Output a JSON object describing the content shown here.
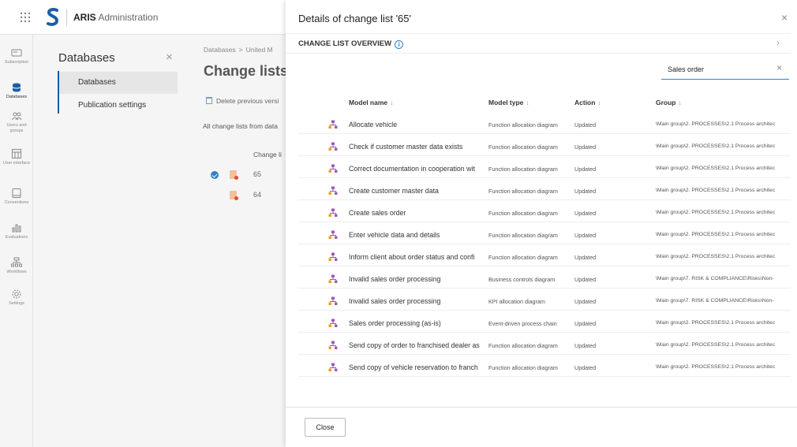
{
  "app": {
    "brand": "ARIS",
    "subtitle": "Administration"
  },
  "rail": [
    {
      "icon": "subscription-icon",
      "label": "Subscription"
    },
    {
      "icon": "database-icon",
      "label": "Databases",
      "active": true
    },
    {
      "icon": "users-icon",
      "label": "Users and groups"
    },
    {
      "icon": "user-interface-icon",
      "label": "User interface"
    },
    {
      "icon": "conventions-icon",
      "label": "Conventions"
    },
    {
      "icon": "evaluations-icon",
      "label": "Evaluations"
    },
    {
      "icon": "workflows-icon",
      "label": "Workflows"
    },
    {
      "icon": "settings-icon",
      "label": "Settings"
    }
  ],
  "subnav": {
    "title": "Databases",
    "close": "×",
    "items": [
      "Databases",
      "Publication settings"
    ]
  },
  "main": {
    "breadcrumb": [
      "Databases",
      "United M"
    ],
    "title": "Change lists",
    "delete_label": "Delete previous versi",
    "description": "All change lists from data",
    "column_header": "Change li",
    "rows": [
      "65",
      "64"
    ]
  },
  "dialog": {
    "title": "Details of change list '65'",
    "close": "×",
    "overview_label": "CHANGE LIST OVERVIEW",
    "overview_chevron": "›",
    "search_value": "Sales order",
    "search_clear": "×",
    "sort_arrow": "↓",
    "columns": [
      "Model name",
      "Model type",
      "Action",
      "Group"
    ],
    "rows": [
      {
        "name": "Allocate vehicle",
        "type": "Function allocation diagram",
        "action": "Updated",
        "group": "\\Main group\\2. PROCESSES\\2.1 Process architec"
      },
      {
        "name": "Check if customer master data exists",
        "type": "Function allocation diagram",
        "action": "Updated",
        "group": "\\Main group\\2. PROCESSES\\2.1 Process architec"
      },
      {
        "name": "Correct documentation in cooperation wit",
        "type": "Function allocation diagram",
        "action": "Updated",
        "group": "\\Main group\\2. PROCESSES\\2.1 Process architec"
      },
      {
        "name": "Create customer master data",
        "type": "Function allocation diagram",
        "action": "Updated",
        "group": "\\Main group\\2. PROCESSES\\2.1 Process architec"
      },
      {
        "name": "Create sales order",
        "type": "Function allocation diagram",
        "action": "Updated",
        "group": "\\Main group\\2. PROCESSES\\2.1 Process architec"
      },
      {
        "name": "Enter vehicle data and details",
        "type": "Function allocation diagram",
        "action": "Updated",
        "group": "\\Main group\\2. PROCESSES\\2.1 Process architec"
      },
      {
        "name": "Inform client about order status and confi",
        "type": "Function allocation diagram",
        "action": "Updated",
        "group": "\\Main group\\2. PROCESSES\\2.1 Process architec"
      },
      {
        "name": "Invalid sales order processing",
        "type": "Business controls diagram",
        "action": "Updated",
        "group": "\\Main group\\7. RISK & COMPLIANCE\\Risks\\Non-"
      },
      {
        "name": "Invalid sales order processing",
        "type": "KPI allocation diagram",
        "action": "Updated",
        "group": "\\Main group\\7. RISK & COMPLIANCE\\Risks\\Non-"
      },
      {
        "name": "Sales order processing (as-is)",
        "type": "Event-driven process chain",
        "action": "Updated",
        "group": "\\Main group\\2. PROCESSES\\2.1 Process architec"
      },
      {
        "name": "Send copy of order to franchised dealer as",
        "type": "Function allocation diagram",
        "action": "Updated",
        "group": "\\Main group\\2. PROCESSES\\2.1 Process architec"
      },
      {
        "name": "Send copy of vehicle reservation to franch",
        "type": "Function allocation diagram",
        "action": "Updated",
        "group": "\\Main group\\2. PROCESSES\\2.1 Process architec"
      }
    ],
    "close_button": "Close"
  },
  "colors": {
    "accent": "#2f80c5",
    "model_icon": "#9b59b6",
    "brand_blue": "#1c5fa8"
  }
}
